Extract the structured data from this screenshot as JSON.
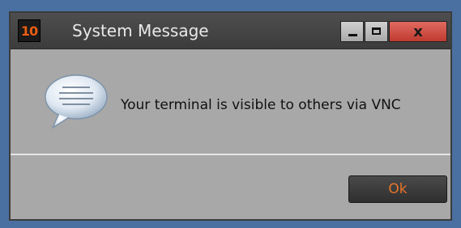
{
  "window": {
    "title": "System Message",
    "app_icon_text": "10",
    "close_label": "x"
  },
  "dialog": {
    "message": "Your terminal is visible to others via VNC",
    "ok_label": "Ok"
  },
  "icons": {
    "app": "app-logo-icon",
    "minimize": "minimize-icon",
    "maximize": "maximize-icon",
    "message": "speech-bubble-icon"
  },
  "colors": {
    "desktop": "#4a6fa1",
    "titlebar": "#444444",
    "dialog_bg": "#a8a8a8",
    "accent": "#e8742a",
    "close": "#d24b40"
  }
}
